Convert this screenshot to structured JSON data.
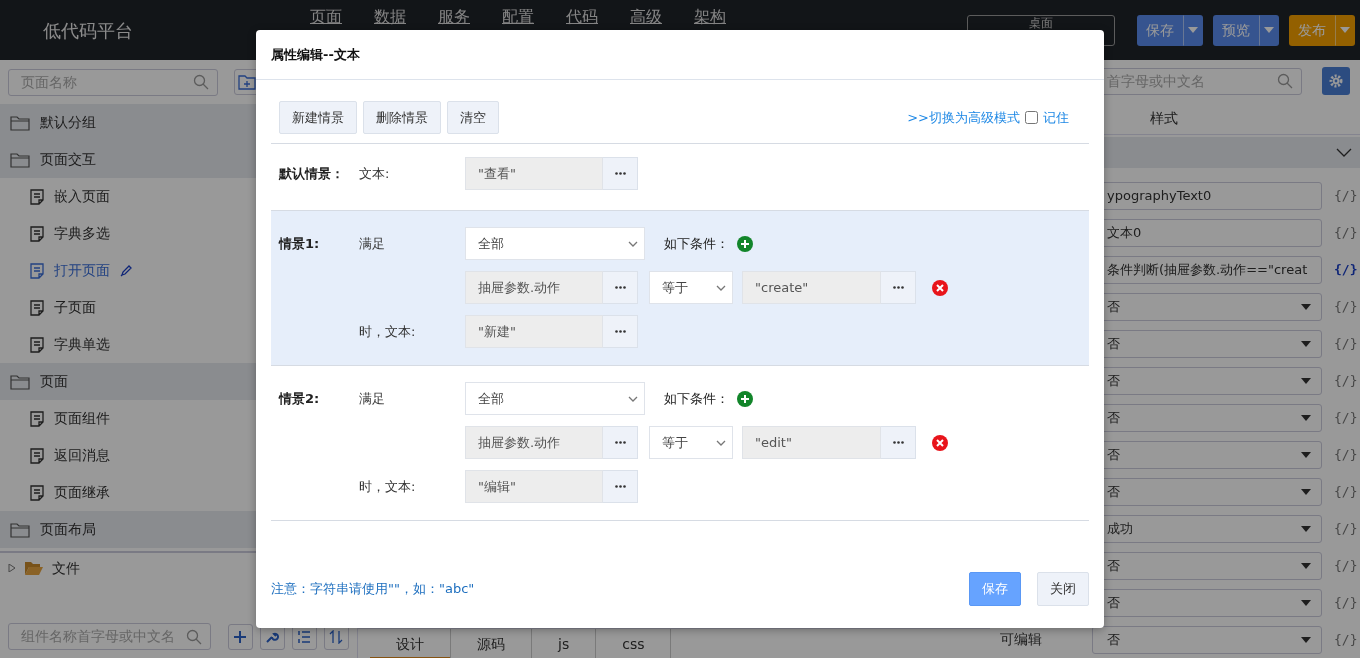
{
  "top_bar": {
    "logo": "低代码平台",
    "nav": [
      "页面",
      "数据",
      "服务",
      "配置",
      "代码",
      "高级",
      "架构"
    ],
    "page_select": "桌面",
    "actions": [
      {
        "label": "保存",
        "kind": "primary"
      },
      {
        "label": "预览",
        "kind": "primary"
      },
      {
        "label": "发布",
        "kind": "publish"
      }
    ]
  },
  "left_panel": {
    "search_placeholder": "页面名称",
    "tree": [
      {
        "label": "默认分组",
        "kind": "group",
        "selected": false
      },
      {
        "label": "页面交互",
        "kind": "group",
        "selected": false,
        "children": [
          {
            "label": "嵌入页面",
            "kind": "page",
            "selected": false
          },
          {
            "label": "字典多选",
            "kind": "page",
            "selected": false
          },
          {
            "label": "打开页面",
            "kind": "page",
            "selected": true
          },
          {
            "label": "子页面",
            "kind": "page",
            "selected": false
          },
          {
            "label": "字典单选",
            "kind": "page",
            "selected": false
          }
        ]
      },
      {
        "label": "页面",
        "kind": "group",
        "selected": false,
        "children": [
          {
            "label": "页面组件",
            "kind": "page",
            "selected": false
          },
          {
            "label": "返回消息",
            "kind": "page",
            "selected": false
          },
          {
            "label": "页面继承",
            "kind": "page",
            "selected": false
          }
        ]
      },
      {
        "label": "页面布局",
        "kind": "group",
        "selected": false
      }
    ],
    "files": {
      "label": "文件",
      "expanded": false
    },
    "component_search_placeholder": "组件名称首字母或中文名"
  },
  "editor_tabs": [
    {
      "label": "设计",
      "selected": true
    },
    {
      "label": "源码",
      "selected": false
    },
    {
      "label": "js",
      "selected": false
    },
    {
      "label": "css",
      "selected": false
    }
  ],
  "right_panel": {
    "search_placeholder": "首字母或中文名",
    "tab": "样式",
    "section_expanded": true,
    "fields": [
      {
        "kind": "input",
        "value": "ypographyText0",
        "bind": "{/}",
        "bound": false
      },
      {
        "kind": "input",
        "value": "文本0",
        "bind": "{/}",
        "bound": false
      },
      {
        "kind": "input",
        "value": "条件判断(抽屉参数.动作==\"creat",
        "bind": "{/}",
        "bound": true
      },
      {
        "kind": "select",
        "value": "否",
        "bind": "{/}",
        "bound": false
      },
      {
        "kind": "select",
        "value": "否",
        "bind": "{/}",
        "bound": false
      },
      {
        "kind": "select",
        "value": "否",
        "bind": "{/}",
        "bound": false
      },
      {
        "kind": "select",
        "value": "否",
        "bind": "{/}",
        "bound": false
      },
      {
        "kind": "select",
        "value": "否",
        "bind": "{/}",
        "bound": false
      },
      {
        "kind": "select",
        "value": "否",
        "bind": "{/}",
        "bound": false
      },
      {
        "kind": "select",
        "value": "成功",
        "bind": "{/}",
        "bound": false
      },
      {
        "kind": "select",
        "value": "否",
        "bind": "{/}",
        "bound": false
      },
      {
        "kind": "select",
        "value": "否",
        "bind": "{/}",
        "bound": false
      },
      {
        "kind": "select",
        "label": "可编辑",
        "value": "否",
        "bind": "{/}",
        "bound": false
      }
    ]
  },
  "dialog": {
    "title": "属性编辑--文本",
    "toolbar": [
      "新建情景",
      "删除情景",
      "清空"
    ],
    "advanced_link": ">>切换为高级模式",
    "remember": {
      "label": "记住",
      "checked": false
    },
    "default_scenario": {
      "label": "默认情景：",
      "field_label": "文本:",
      "value": "\"查看\""
    },
    "scenarios": [
      {
        "label": "情景1:",
        "match_label": "满足",
        "match": "全部",
        "conditions_label": "如下条件：",
        "selected": true,
        "conditions": [
          {
            "left": "抽屉参数.动作",
            "operator": "等于",
            "right": "\"create\""
          }
        ],
        "then_label": "时，文本:",
        "value": "\"新建\""
      },
      {
        "label": "情景2:",
        "match_label": "满足",
        "match": "全部",
        "conditions_label": "如下条件：",
        "selected": false,
        "conditions": [
          {
            "left": "抽屉参数.动作",
            "operator": "等于",
            "right": "\"edit\""
          }
        ],
        "then_label": "时，文本:",
        "value": "\"编辑\""
      }
    ],
    "note": "注意：字符串请使用\"\"，如：\"abc\"",
    "buttons": [
      {
        "label": "保存",
        "kind": "primary"
      },
      {
        "label": "关闭",
        "kind": "secondary"
      }
    ]
  }
}
